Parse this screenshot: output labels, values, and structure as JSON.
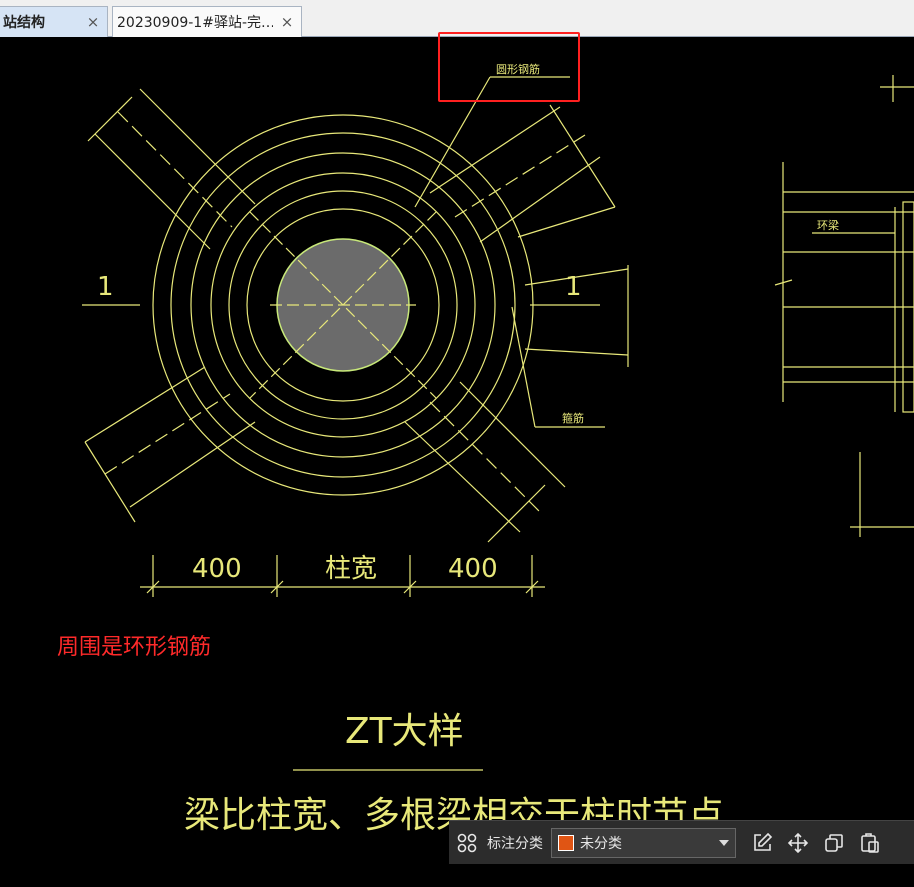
{
  "tabs": [
    {
      "label": "站结构",
      "close": "×"
    },
    {
      "label": "20230909-1#驿站-完…",
      "close": "×"
    }
  ],
  "drawing": {
    "callout_label_top": "圆形钢筋",
    "callout_label_bottom": "箍筋",
    "section_mark_left": "1",
    "section_mark_right": "1",
    "side_label": "环梁",
    "dim_left": "400",
    "dim_center": "柱宽",
    "dim_right": "400",
    "title": "ZT大样",
    "subtitle": "梁比柱宽、多根梁相交于柱时节点"
  },
  "annotation_note": "周围是环形钢筋",
  "toolbar": {
    "layout_icon": "grid-icon",
    "label": "标注分类",
    "select_value": "未分类",
    "swatch_color": "#e05514",
    "icons": [
      "edit-icon",
      "move-icon",
      "copy-icon",
      "paste-icon"
    ]
  },
  "colors": {
    "cad_line": "#e8e87a",
    "column_fill": "#6b6b6b",
    "highlight": "#ff2020",
    "note": "#ff2a2a"
  }
}
